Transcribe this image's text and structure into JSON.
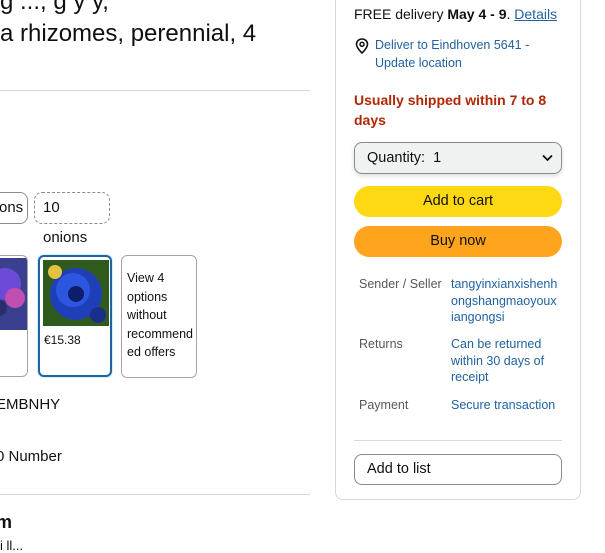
{
  "product": {
    "title_line1": "g ..., g y y,",
    "title_line2": "a rhizomes, perennial, 4"
  },
  "options": {
    "buttons": [
      {
        "label": "ons"
      },
      {
        "label": "10 onions"
      }
    ],
    "swatches": [
      {
        "price": ""
      },
      {
        "price": "€15.38"
      }
    ],
    "view_options_text": "View 4 options without recommend ed offers"
  },
  "left_fragments": {
    "brand_fragment": "EMBNHY",
    "number_fragment": "0 Number",
    "heading_fragment": "m",
    "bottom_text_fragment": "i ll..."
  },
  "delivery": {
    "prefix": "FREE delivery ",
    "date": "May 4 - 9",
    "dot": ". ",
    "details_link": "Details"
  },
  "location": {
    "line1": "Deliver to Eindhoven 5641 -",
    "line2": "Update location"
  },
  "shipping_notice": {
    "line1": "Usually shipped within 7 to 8",
    "line2": "days"
  },
  "quantity": {
    "label": "Quantity:",
    "value": "1"
  },
  "buttons": {
    "add_to_cart": "Add to cart",
    "buy_now": "Buy now",
    "add_to_list": "Add to list"
  },
  "info": {
    "seller_label": "Sender / Seller",
    "seller_name_l1": "tangyinxianxishenh",
    "seller_name_l2": "ongshangmaoyoux",
    "seller_name_l3": "iangongsi",
    "returns_label": "Returns",
    "returns_l1": "Can be returned",
    "returns_l2": "within 30 days of",
    "returns_l3": "receipt",
    "payment_label": "Payment",
    "payment_value": "Secure transaction"
  },
  "colors": {
    "cart_button": "#ffd814",
    "buy_button": "#ffa41c",
    "link": "#2162a1",
    "shipping_warning": "#b12704"
  }
}
